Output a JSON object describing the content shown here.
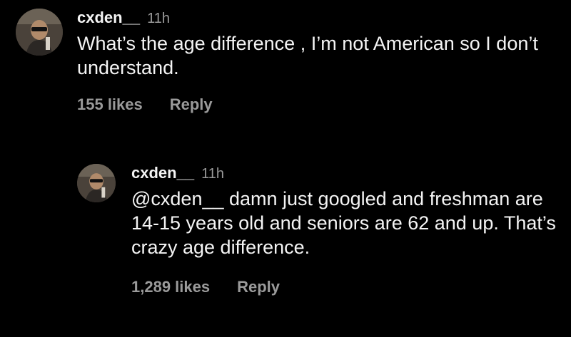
{
  "comments": [
    {
      "username": "cxden__",
      "time": "11h",
      "text": "What’s the age difference , I’m not American so I don’t understand.",
      "likes": "155 likes",
      "reply_label": "Reply"
    },
    {
      "username": "cxden__",
      "time": "11h",
      "text": "@cxden__ damn just googled and freshman are 14-15 years old and seniors are 62 and up. That’s crazy age difference.",
      "likes": "1,289 likes",
      "reply_label": "Reply"
    }
  ],
  "colors": {
    "background": "#000000",
    "text": "#f4f4f4",
    "muted": "#9a9a9a"
  }
}
